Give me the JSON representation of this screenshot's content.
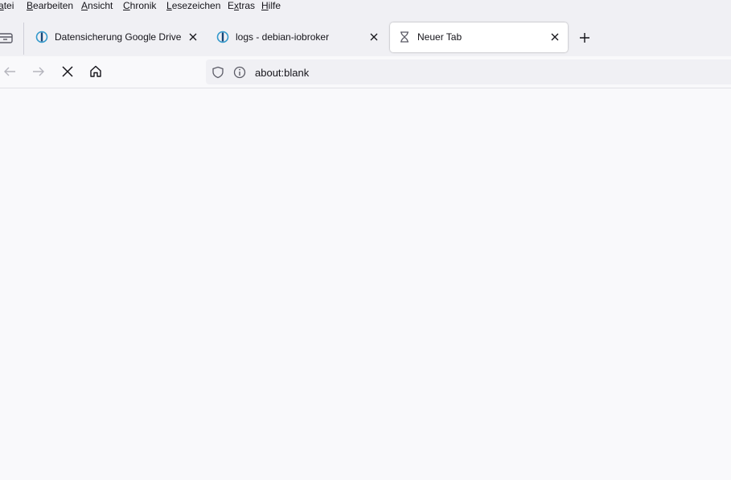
{
  "menubar": {
    "items": [
      {
        "pre": "",
        "accel": "a",
        "post": "tei",
        "display_prefix": ""
      },
      {
        "pre": "",
        "accel": "B",
        "post": "earbeiten"
      },
      {
        "pre": "",
        "accel": "A",
        "post": "nsicht"
      },
      {
        "pre": "",
        "accel": "C",
        "post": "hronik"
      },
      {
        "pre": "",
        "accel": "L",
        "post": "esezeichen"
      },
      {
        "pre": "E",
        "accel": "x",
        "post": "tras"
      },
      {
        "pre": "",
        "accel": "H",
        "post": "ilfe"
      }
    ]
  },
  "tabs": [
    {
      "title": "Datensicherung Google Drive",
      "icon": "iobroker-icon",
      "active": false
    },
    {
      "title": "logs - debian-iobroker",
      "icon": "iobroker-icon",
      "active": false
    },
    {
      "title": "Neuer Tab",
      "icon": "hourglass-icon",
      "active": true
    }
  ],
  "urlbar": {
    "url": "about:blank"
  },
  "colors": {
    "toolbar_bg": "#f0f0f4",
    "content_bg": "#f9f9fb",
    "iobroker_blue": "#3399cc",
    "icon_gray": "#5b5b66"
  }
}
